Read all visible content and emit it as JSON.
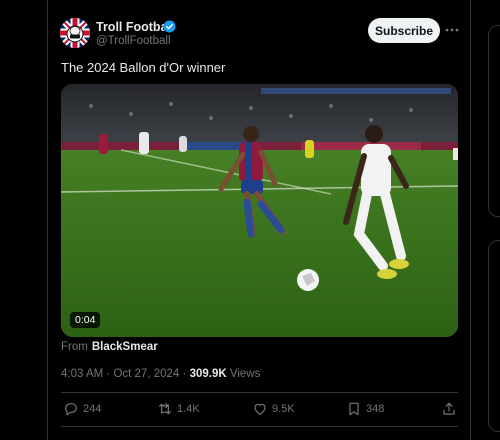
{
  "tweet": {
    "author": {
      "name": "Troll Football",
      "handle": "@TrollFootball",
      "verified": true
    },
    "subscribe_label": "Subscribe",
    "text": "The 2024 Ballon d'Or winner",
    "media": {
      "duration": "0:04"
    },
    "source": {
      "prefix": "From",
      "name": "BlackSmear"
    },
    "meta": {
      "time": "4:03 AM",
      "separator": "·",
      "date": "Oct 27, 2024",
      "views_count": "309.9K",
      "views_label": "Views"
    },
    "actions": {
      "replies": "244",
      "retweets": "1.4K",
      "likes": "9.5K",
      "bookmarks": "348"
    }
  },
  "colors": {
    "background": "#000000",
    "text": "#e7e9ea",
    "muted": "#71767b",
    "verified": "#1d9bf0",
    "border": "#2f3336"
  },
  "icons": [
    "avatar-flag-icon",
    "verified-badge-icon",
    "more-options-icon",
    "reply-icon",
    "retweet-icon",
    "like-icon",
    "bookmark-icon",
    "share-icon"
  ]
}
